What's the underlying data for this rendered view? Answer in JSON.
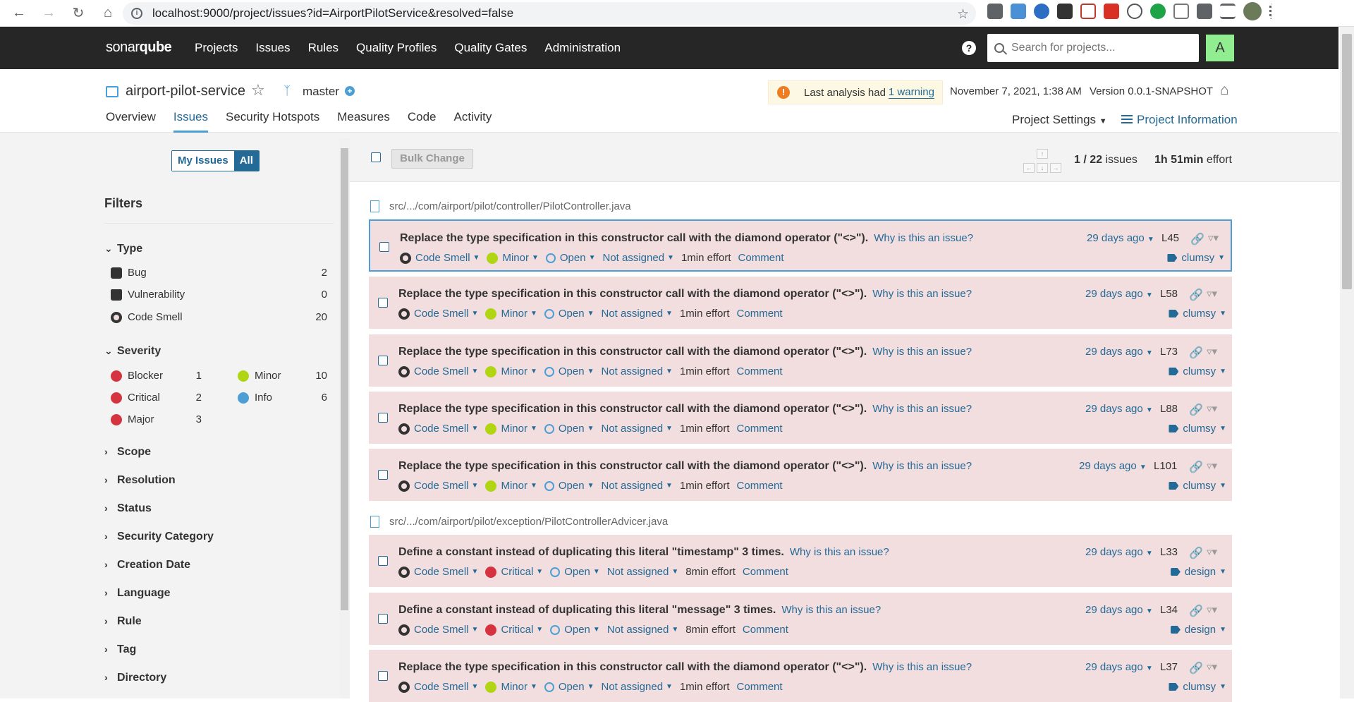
{
  "browser": {
    "url": "localhost:9000/project/issues?id=AirportPilotService&resolved=false"
  },
  "topnav": {
    "logo_main": "sonar",
    "logo_sub": "qube",
    "menu": [
      "Projects",
      "Issues",
      "Rules",
      "Quality Profiles",
      "Quality Gates",
      "Administration"
    ],
    "search_placeholder": "Search for projects...",
    "avatar": "A"
  },
  "project": {
    "name": "airport-pilot-service",
    "branch": "master",
    "warning_prefix": "Last analysis had",
    "warning_link": "1 warning",
    "date": "November 7, 2021, 1:38 AM",
    "version": "Version 0.0.1-SNAPSHOT",
    "tabs": [
      "Overview",
      "Issues",
      "Security Hotspots",
      "Measures",
      "Code",
      "Activity"
    ],
    "settings": "Project Settings",
    "info": "Project Information"
  },
  "sidebar": {
    "my_issues": "My Issues",
    "all": "All",
    "filters_title": "Filters",
    "type": {
      "title": "Type",
      "items": [
        {
          "label": "Bug",
          "count": "2"
        },
        {
          "label": "Vulnerability",
          "count": "0"
        },
        {
          "label": "Code Smell",
          "count": "20"
        }
      ]
    },
    "severity": {
      "title": "Severity",
      "items": [
        {
          "label": "Blocker",
          "count": "1"
        },
        {
          "label": "Critical",
          "count": "2"
        },
        {
          "label": "Major",
          "count": "3"
        },
        {
          "label": "Minor",
          "count": "10"
        },
        {
          "label": "Info",
          "count": "6"
        }
      ]
    },
    "collapsed": [
      "Scope",
      "Resolution",
      "Status",
      "Security Category",
      "Creation Date",
      "Language",
      "Rule",
      "Tag",
      "Directory"
    ]
  },
  "toolbar": {
    "bulk_change": "Bulk Change",
    "position": "1 / 22",
    "issues_label": "issues",
    "effort": "1h 51min",
    "effort_label": "effort"
  },
  "files": [
    "src/.../com/airport/pilot/controller/PilotController.java",
    "src/.../com/airport/pilot/exception/PilotControllerAdvicer.java"
  ],
  "issues": [
    {
      "message": "Replace the type specification in this constructor call with the diamond operator (\"<>\").",
      "type": "Code Smell",
      "severity": "Minor",
      "status": "Open",
      "assignee": "Not assigned",
      "effort": "1min effort",
      "comment": "Comment",
      "age": "29 days ago",
      "line": "L45",
      "tag": "clumsy",
      "why": "Why is this an issue?"
    },
    {
      "message": "Replace the type specification in this constructor call with the diamond operator (\"<>\").",
      "type": "Code Smell",
      "severity": "Minor",
      "status": "Open",
      "assignee": "Not assigned",
      "effort": "1min effort",
      "comment": "Comment",
      "age": "29 days ago",
      "line": "L58",
      "tag": "clumsy",
      "why": "Why is this an issue?"
    },
    {
      "message": "Replace the type specification in this constructor call with the diamond operator (\"<>\").",
      "type": "Code Smell",
      "severity": "Minor",
      "status": "Open",
      "assignee": "Not assigned",
      "effort": "1min effort",
      "comment": "Comment",
      "age": "29 days ago",
      "line": "L73",
      "tag": "clumsy",
      "why": "Why is this an issue?"
    },
    {
      "message": "Replace the type specification in this constructor call with the diamond operator (\"<>\").",
      "type": "Code Smell",
      "severity": "Minor",
      "status": "Open",
      "assignee": "Not assigned",
      "effort": "1min effort",
      "comment": "Comment",
      "age": "29 days ago",
      "line": "L88",
      "tag": "clumsy",
      "why": "Why is this an issue?"
    },
    {
      "message": "Replace the type specification in this constructor call with the diamond operator (\"<>\").",
      "type": "Code Smell",
      "severity": "Minor",
      "status": "Open",
      "assignee": "Not assigned",
      "effort": "1min effort",
      "comment": "Comment",
      "age": "29 days ago",
      "line": "L101",
      "tag": "clumsy",
      "why": "Why is this an issue?"
    },
    {
      "message": "Define a constant instead of duplicating this literal \"timestamp\" 3 times.",
      "type": "Code Smell",
      "severity": "Critical",
      "status": "Open",
      "assignee": "Not assigned",
      "effort": "8min effort",
      "comment": "Comment",
      "age": "29 days ago",
      "line": "L33",
      "tag": "design",
      "why": "Why is this an issue?"
    },
    {
      "message": "Define a constant instead of duplicating this literal \"message\" 3 times.",
      "type": "Code Smell",
      "severity": "Critical",
      "status": "Open",
      "assignee": "Not assigned",
      "effort": "8min effort",
      "comment": "Comment",
      "age": "29 days ago",
      "line": "L34",
      "tag": "design",
      "why": "Why is this an issue?"
    },
    {
      "message": "Replace the type specification in this constructor call with the diamond operator (\"<>\").",
      "type": "Code Smell",
      "severity": "Minor",
      "status": "Open",
      "assignee": "Not assigned",
      "effort": "1min effort",
      "comment": "Comment",
      "age": "29 days ago",
      "line": "L37",
      "tag": "clumsy",
      "why": "Why is this an issue?"
    }
  ]
}
